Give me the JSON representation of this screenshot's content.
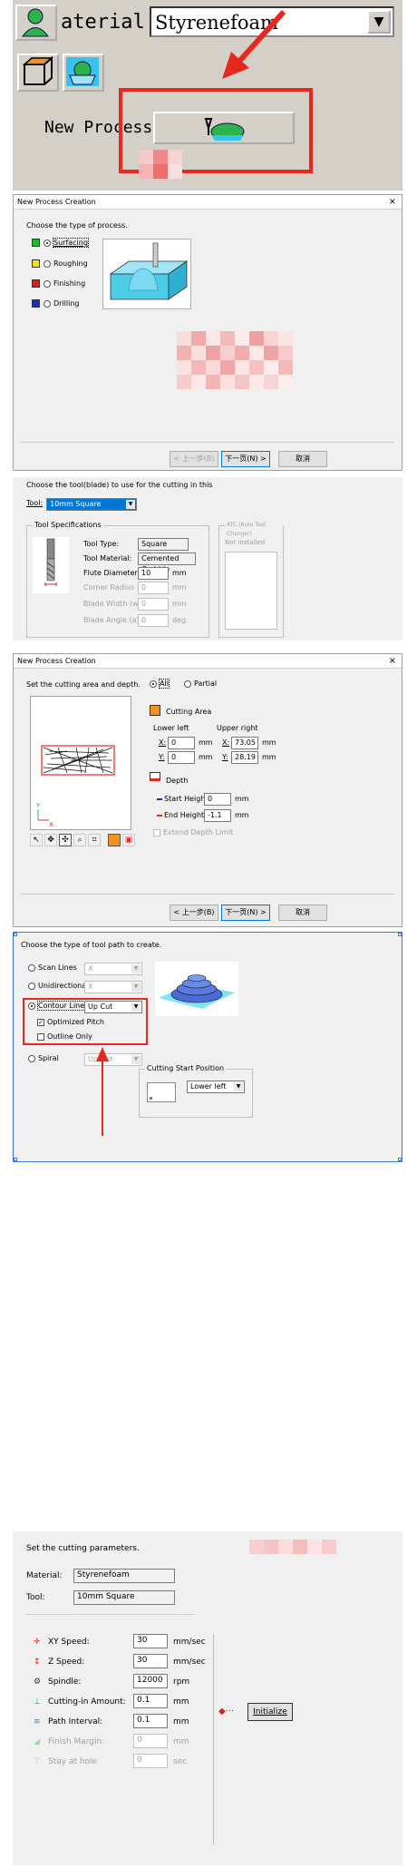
{
  "panel1": {
    "material_label": "aterial",
    "material_value": "Styrenefoam",
    "new_process_label": "New Process"
  },
  "panel2": {
    "title": "New Process Creation",
    "close": "×",
    "prompt": "Choose the type of process.",
    "options": [
      "Surfacing",
      "Roughing",
      "Finishing",
      "Drilling"
    ],
    "back": "< 上一步(B)",
    "next": "下一页(N) >",
    "cancel": "取消"
  },
  "panel3": {
    "prompt": "Choose the tool(blade) to use for the cutting in this",
    "tool_label": "Tool:",
    "tool_value": "10mm Square",
    "spec_title": "Tool Specifications",
    "atc_title": "ATC (Auto Tool Changer)",
    "atc_value": "Not installed",
    "rows": [
      {
        "label": "Tool Type:",
        "value": "Square",
        "unit": ""
      },
      {
        "label": "Tool Material:",
        "value": "Cemented Carbide",
        "unit": ""
      },
      {
        "label": "Flute Diameter",
        "value": "10",
        "unit": "mm"
      },
      {
        "label": "Corner Radius",
        "value": "0",
        "unit": "mm"
      },
      {
        "label": "Blade Width (w)",
        "value": "0",
        "unit": "mm"
      },
      {
        "label": "Blade Angle (a)",
        "value": "0",
        "unit": "deg."
      }
    ]
  },
  "panel4": {
    "title": "New Process Creation",
    "close": "×",
    "prompt": "Set the cutting area and depth.",
    "all": "All",
    "partial": "Partial",
    "cutting_area": "Cutting Area",
    "lower_left": "Lower left",
    "upper_right": "Upper right",
    "x_label": "X:",
    "y_label": "Y:",
    "ll_x": "0",
    "ll_y": "0",
    "ur_x": "73.05",
    "ur_y": "28.19",
    "mm": "mm",
    "depth": "Depth",
    "start_height_label": "Start Height:",
    "start_height": "0",
    "end_height_label": "End Height:",
    "end_height": "-1.1",
    "extend_depth": "Extend Depth Limit",
    "back": "< 上一步(B)",
    "next": "下一页(N) >",
    "cancel": "取消",
    "axis_y": "Y",
    "axis_x": "X"
  },
  "panel5": {
    "prompt": "Choose the type of tool path to create.",
    "scan_lines": "Scan Lines",
    "scan_value": "X",
    "unidirectional": "Unidirectional",
    "uni_value": "X",
    "contour_lines": "Contour Lines",
    "contour_value": "Up Cut",
    "optimized_pitch": "Optimized Pitch",
    "outline_only": "Outline Only",
    "spiral": "Spiral",
    "spiral_value": "Up Cut",
    "start_pos_title": "Cutting Start Position",
    "start_pos_value": "Lower left"
  },
  "panel6": {
    "prompt": "Set the cutting parameters.",
    "material_label": "Material:",
    "material_value": "Styrenefoam",
    "tool_label": "Tool:",
    "tool_value": "10mm Square",
    "params": [
      {
        "label": "XY Speed:",
        "value": "30",
        "unit": "mm/sec",
        "enabled": true
      },
      {
        "label": "Z Speed:",
        "value": "30",
        "unit": "mm/sec",
        "enabled": true
      },
      {
        "label": "Spindle:",
        "value": "12000",
        "unit": "rpm",
        "enabled": true
      },
      {
        "label": "Cutting-in Amount:",
        "value": "0.1",
        "unit": "mm",
        "enabled": true
      },
      {
        "label": "Path Interval:",
        "value": "0.1",
        "unit": "mm",
        "enabled": true
      },
      {
        "label": "Finish Margin:",
        "value": "0",
        "unit": "mm",
        "enabled": false
      },
      {
        "label": "Stay at hole",
        "value": "0",
        "unit": "sec",
        "enabled": false
      }
    ],
    "initialize": "Initialize"
  }
}
